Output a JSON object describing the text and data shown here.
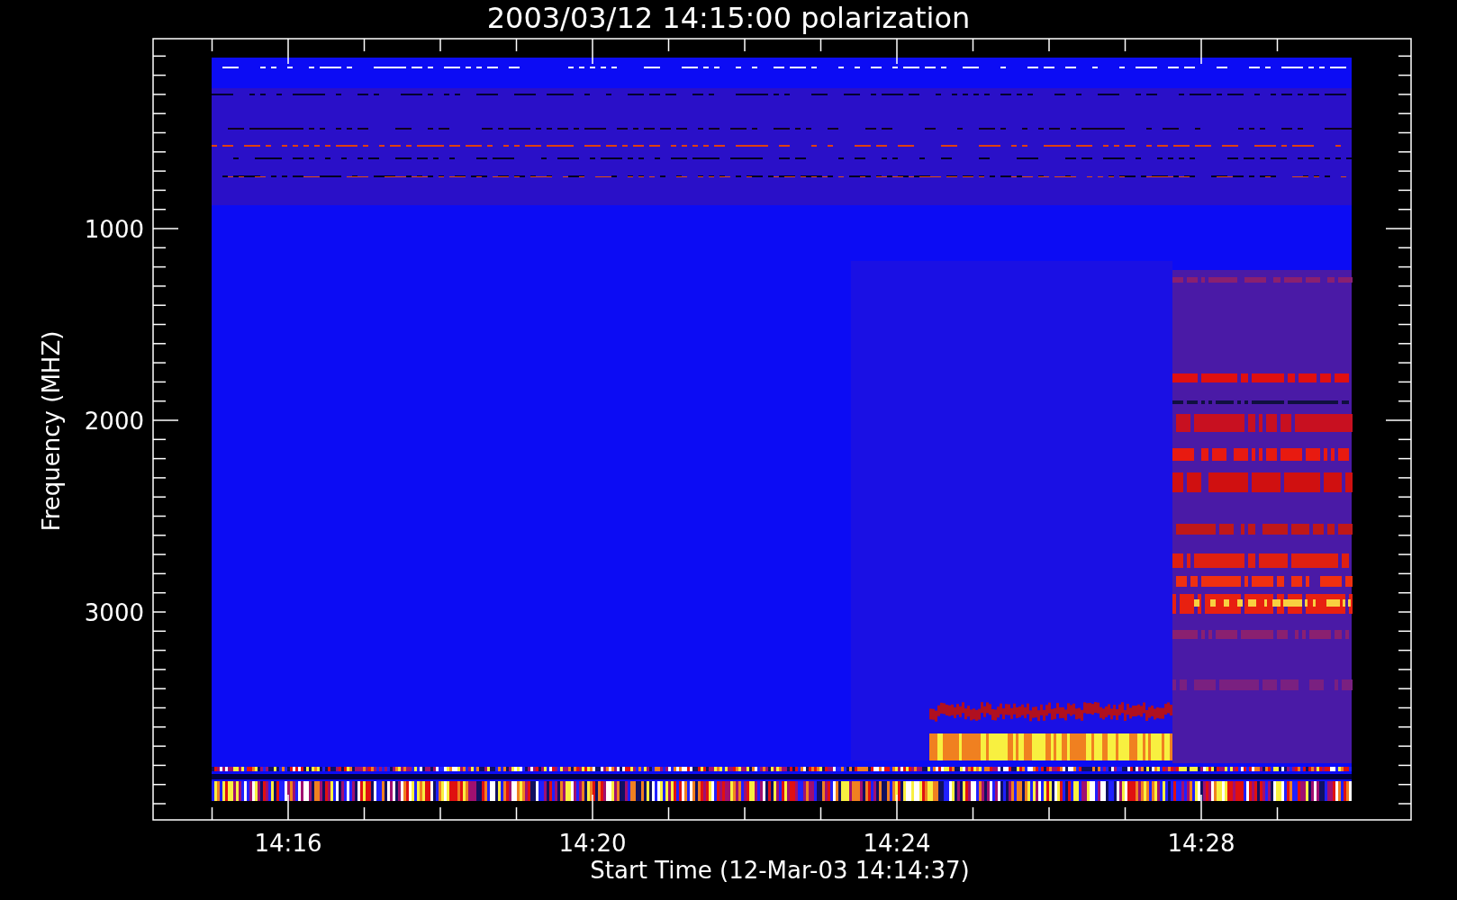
{
  "title": "2003/03/12 14:15:00 polarization",
  "x_axis": {
    "label": "Start Time (12-Mar-03 14:14:37)",
    "ticks": [
      "14:16",
      "14:20",
      "14:24",
      "14:28"
    ]
  },
  "y_axis": {
    "label": "Frequency (MHZ)",
    "ticks": [
      "1000",
      "2000",
      "3000"
    ]
  }
}
